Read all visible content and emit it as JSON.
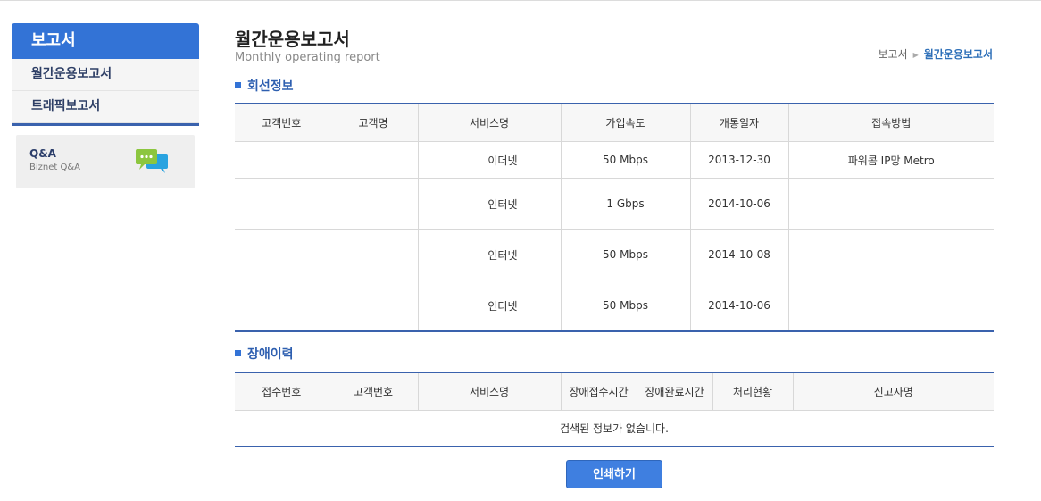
{
  "sidebar": {
    "title": "보고서",
    "items": [
      {
        "label": "월간운용보고서"
      },
      {
        "label": "트래픽보고서"
      }
    ],
    "qa": {
      "title": "Q&A",
      "subtitle": "Biznet Q&A",
      "icon": "chat-bubbles-icon",
      "icon_colors": [
        "#8cc63f",
        "#29a3e0"
      ]
    }
  },
  "page": {
    "title": "월간운용보고서",
    "subtitle": "Monthly operating report",
    "breadcrumb": {
      "parent": "보고서",
      "current": "월간운용보고서"
    }
  },
  "line_info": {
    "section_title": "회선정보",
    "headers": [
      "고객번호",
      "고객명",
      "서비스명",
      "가입속도",
      "개통일자",
      "접속방법"
    ],
    "rows": [
      [
        "",
        "",
        "이더넷",
        "50 Mbps",
        "2013-12-30",
        "파워콤 IP망 Metro"
      ],
      [
        "",
        "",
        "인터넷",
        "1 Gbps",
        "2014-10-06",
        ""
      ],
      [
        "",
        "",
        "인터넷",
        "50 Mbps",
        "2014-10-08",
        ""
      ],
      [
        "",
        "",
        "인터넷",
        "50 Mbps",
        "2014-10-06",
        ""
      ]
    ]
  },
  "failure_history": {
    "section_title": "장애이력",
    "headers": [
      "접수번호",
      "고객번호",
      "서비스명",
      "장애접수시간",
      "장애완료시간",
      "처리현황",
      "신고자명"
    ],
    "empty_message": "검색된 정보가 없습니다."
  },
  "actions": {
    "print_label": "인쇄하기"
  },
  "colors": {
    "accent": "#3373d6",
    "table_border": "#3a62ad",
    "button": "#3f7fe0"
  }
}
